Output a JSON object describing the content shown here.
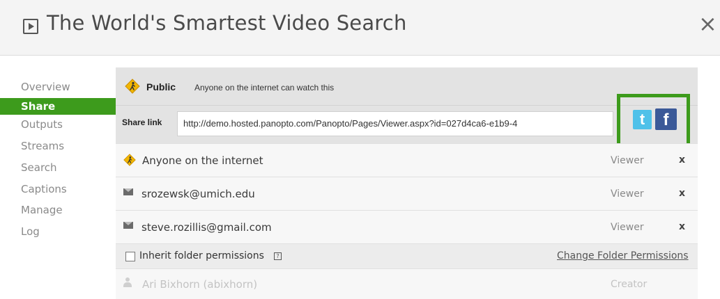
{
  "header": {
    "title": "The World's Smartest Video Search",
    "title_icon": "play-box-icon",
    "close_glyph": "×"
  },
  "sidebar": {
    "items": [
      {
        "label": "Overview",
        "active": false
      },
      {
        "label": "Share",
        "active": true
      },
      {
        "label": "Outputs",
        "active": false
      },
      {
        "label": "Streams",
        "active": false
      },
      {
        "label": "Search",
        "active": false
      },
      {
        "label": "Captions",
        "active": false
      },
      {
        "label": "Manage",
        "active": false
      },
      {
        "label": "Log",
        "active": false
      }
    ]
  },
  "share": {
    "visibility": {
      "label": "Public",
      "description": "Anyone on the internet can watch this",
      "icon": "pedestrian-sign-icon"
    },
    "link": {
      "label": "Share link",
      "value": "http://demo.hosted.panopto.com/Panopto/Pages/Viewer.aspx?id=027d4ca6-e1b9-4"
    },
    "social": {
      "twitter_glyph": "t",
      "facebook_glyph": "f",
      "highlight_color": "#3d9b1c"
    },
    "permissions": [
      {
        "name": "Anyone on the internet",
        "role": "Viewer",
        "remove": "x",
        "icon": "pedestrian-sign-icon"
      },
      {
        "name": "srozewsk@umich.edu",
        "role": "Viewer",
        "remove": "x",
        "icon": "envelope-icon"
      },
      {
        "name": "steve.rozillis@gmail.com",
        "role": "Viewer",
        "remove": "x",
        "icon": "envelope-icon"
      }
    ],
    "inherit": {
      "label": "Inherit folder permissions",
      "help_glyph": "?",
      "checked": false,
      "change_link": "Change Folder Permissions"
    },
    "creator": {
      "name": "Ari Bixhorn (abixhorn)",
      "role": "Creator",
      "icon": "person-icon"
    }
  },
  "colors": {
    "accent_green": "#3d9b1c",
    "twitter": "#4fc1e9",
    "facebook": "#3b5998"
  }
}
